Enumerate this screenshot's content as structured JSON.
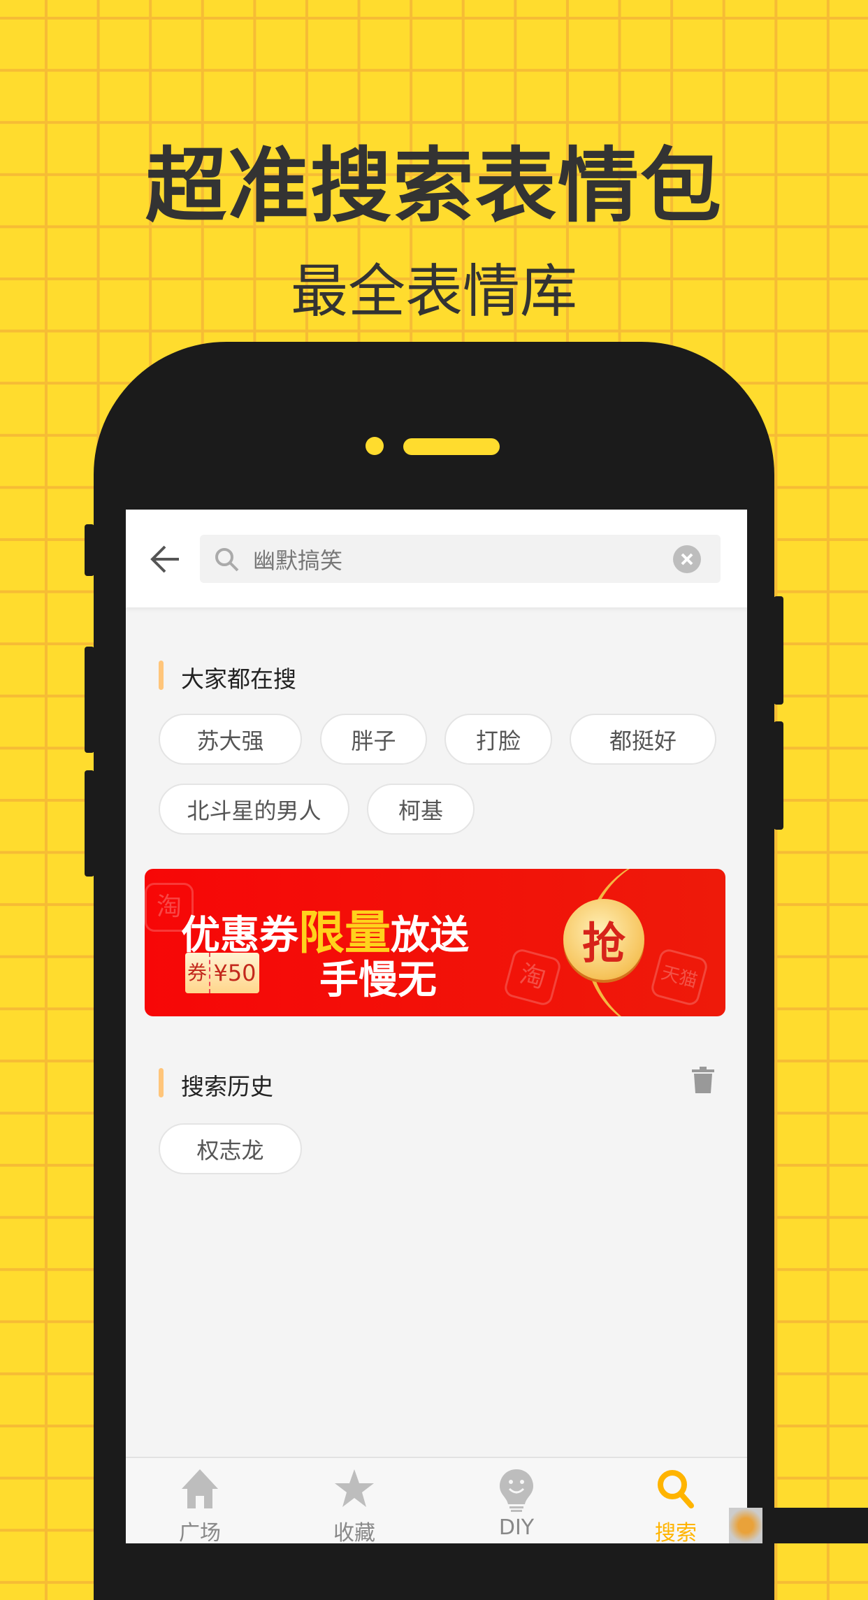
{
  "promo": {
    "headline": "超准搜索表情包",
    "subheadline": "最全表情库"
  },
  "search": {
    "value": "幽默搞笑",
    "icon": "search-icon",
    "clear_icon": "clear-icon",
    "back_icon": "back-arrow-icon"
  },
  "hot": {
    "title": "大家都在搜",
    "tags": [
      "苏大强",
      "胖子",
      "打脸",
      "都挺好",
      "北斗星的男人",
      "柯基"
    ]
  },
  "banner": {
    "line1_a": "优惠券",
    "line1_b": "限量",
    "line1_c": "放送",
    "coupon_label": "券",
    "coupon_value": "¥50",
    "line2": "手慢无",
    "grab": "抢",
    "brand_marks": [
      "淘",
      "天猫"
    ]
  },
  "history": {
    "title": "搜索历史",
    "tags": [
      "权志龙"
    ],
    "clear_icon": "trash-icon"
  },
  "nav": {
    "items": [
      {
        "label": "广场",
        "icon": "home-icon"
      },
      {
        "label": "收藏",
        "icon": "star-icon"
      },
      {
        "label": "DIY",
        "icon": "bulb-smile-icon"
      },
      {
        "label": "搜索",
        "icon": "search-icon",
        "active": true
      }
    ],
    "active_color": "#FFB400",
    "inactive_color": "#BDBDBD"
  },
  "colors": {
    "background": "#FFDC2E",
    "grid": "#F6BC35",
    "phone": "#1B1B1B",
    "accent_marker": "#FFC57A",
    "banner_red": "#F70707"
  }
}
